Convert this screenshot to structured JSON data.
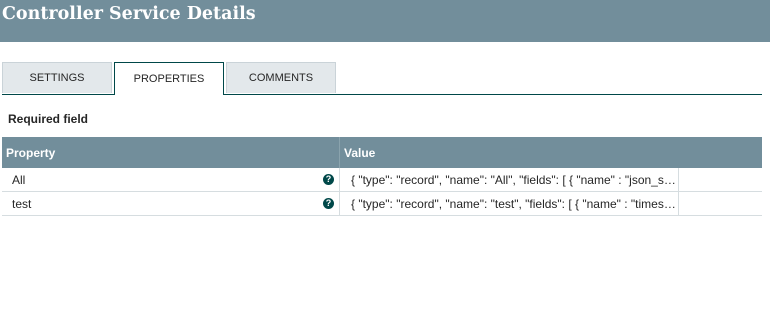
{
  "header": {
    "title": "Controller Service Details"
  },
  "tabs": [
    {
      "label": "SETTINGS",
      "active": false
    },
    {
      "label": "PROPERTIES",
      "active": true
    },
    {
      "label": "COMMENTS",
      "active": false
    }
  ],
  "required_label": "Required field",
  "table": {
    "columns": [
      "Property",
      "Value"
    ],
    "rows": [
      {
        "property": "All",
        "value": "{ \"type\": \"record\", \"name\": \"All\", \"fields\": [ { \"name\" : \"json_str\", \"type\" : \"string\" } ] }",
        "icon": "help-icon"
      },
      {
        "property": "test",
        "value": "{ \"type\": \"record\", \"name\": \"test\", \"fields\": [ { \"name\" : \"timestamp\", \"type\" : \"string\" } ] }",
        "icon": "help-icon"
      }
    ]
  },
  "colors": {
    "header_bg": "#728e9b",
    "active_tab_border": "#004849",
    "tab_bg": "#e3e8eb"
  }
}
